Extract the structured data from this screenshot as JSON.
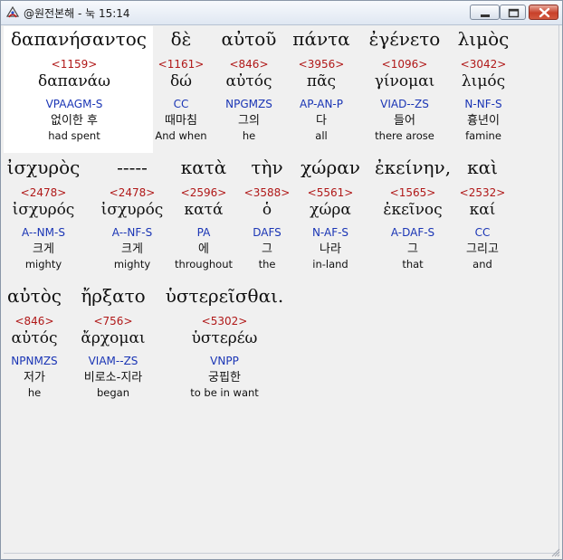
{
  "window": {
    "title": "@원전본해 - 눅 15:14",
    "icon": "app-logo-icon",
    "controls": [
      "minimize-icon",
      "maximize-icon",
      "close-icon"
    ]
  },
  "words": [
    {
      "greek": "δαπανήσαντος",
      "strong": "<1159>",
      "lemma": "δαπανάω",
      "morph": "VPAAGM-S",
      "korean": "없이한 후",
      "english": "had spent"
    },
    {
      "greek": "δὲ",
      "strong": "<1161>",
      "lemma": "δώ",
      "morph": "CC",
      "korean": "때마침",
      "english": "And when"
    },
    {
      "greek": "αὐτοῦ",
      "strong": "<846>",
      "lemma": "αὐτός",
      "morph": "NPGMZS",
      "korean": "그의",
      "english": "he"
    },
    {
      "greek": "πάντα",
      "strong": "<3956>",
      "lemma": "πᾶς",
      "morph": "AP-AN-P",
      "korean": "다",
      "english": "all"
    },
    {
      "greek": "ἐγένετο",
      "strong": "<1096>",
      "lemma": "γίνομαι",
      "morph": "VIAD--ZS",
      "korean": "들어",
      "english": "there arose"
    },
    {
      "greek": "λιμὸς",
      "strong": "<3042>",
      "lemma": "λιμός",
      "morph": "N-NF-S",
      "korean": "흉년이",
      "english": "famine"
    },
    {
      "greek": "ἰσχυρὸς",
      "strong": "<2478>",
      "lemma": "ἰσχυρός",
      "morph": "A--NM-S",
      "korean": "크게",
      "english": "mighty"
    },
    {
      "greek": "-----",
      "strong": "<2478>",
      "lemma": "ἰσχυρός",
      "morph": "A--NF-S",
      "korean": "크게",
      "english": "mighty"
    },
    {
      "greek": "κατὰ",
      "strong": "<2596>",
      "lemma": "κατά",
      "morph": "PA",
      "korean": "에",
      "english": "throughout"
    },
    {
      "greek": "τὴν",
      "strong": "<3588>",
      "lemma": "ὁ",
      "morph": "DAFS",
      "korean": "그",
      "english": "the"
    },
    {
      "greek": "χώραν",
      "strong": "<5561>",
      "lemma": "χώρα",
      "morph": "N-AF-S",
      "korean": "나라",
      "english": "in-land"
    },
    {
      "greek": "ἐκείνην,",
      "strong": "<1565>",
      "lemma": "ἐκεῖνος",
      "morph": "A-DAF-S",
      "korean": "그",
      "english": "that"
    },
    {
      "greek": "καὶ",
      "strong": "<2532>",
      "lemma": "καί",
      "morph": "CC",
      "korean": "그리고",
      "english": "and"
    },
    {
      "greek": "αὐτὸς",
      "strong": "<846>",
      "lemma": "αὐτός",
      "morph": "NPNMZS",
      "korean": "저가",
      "english": "he"
    },
    {
      "greek": "ἤρξατο",
      "strong": "<756>",
      "lemma": "ἄρχομαι",
      "morph": "VIAM--ZS",
      "korean": "비로소-지라",
      "english": "began"
    },
    {
      "greek": "ὑστερεῖσθαι.",
      "strong": "<5302>",
      "lemma": "ὑστερέω",
      "morph": "VNPP",
      "korean": "궁핍한",
      "english": "to be in want"
    }
  ]
}
